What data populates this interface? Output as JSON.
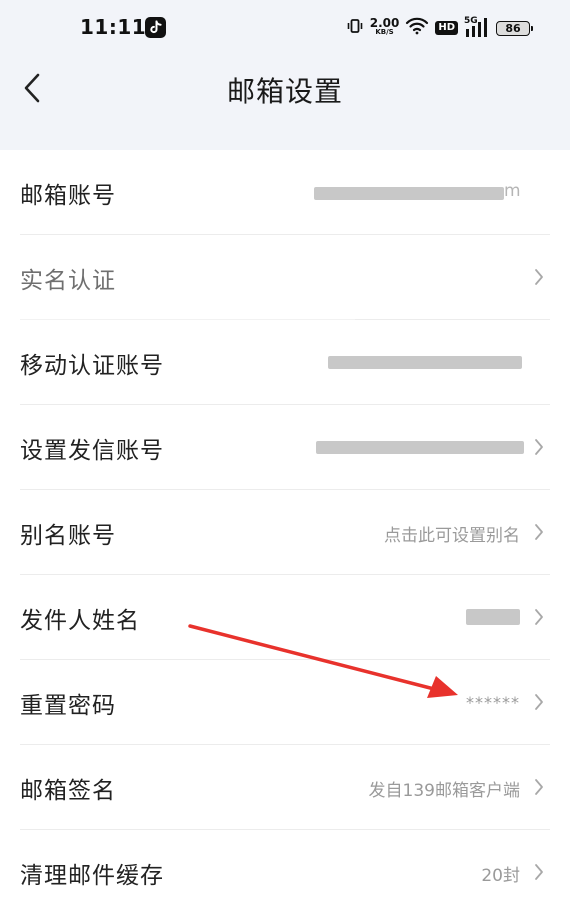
{
  "status_bar": {
    "time": "11:11",
    "net_speed_value": "2.00",
    "net_speed_unit": "KB/S",
    "hd_label": "HD",
    "signal_label": "5G",
    "battery": "86"
  },
  "header": {
    "title": "邮箱设置",
    "back_icon": "chevron-left-icon"
  },
  "settings": {
    "items": [
      {
        "label": "邮箱账号",
        "value": "m",
        "redacted": true
      },
      {
        "label": "实名认证",
        "value": ""
      },
      {
        "label": "移动认证账号",
        "value": "",
        "redacted": true
      },
      {
        "label": "设置发信账号",
        "value": "",
        "redacted": true
      },
      {
        "label": "别名账号",
        "value": "点击此可设置别名"
      },
      {
        "label": "发件人姓名",
        "value": "",
        "redacted": true
      },
      {
        "label": "重置密码",
        "value": "******"
      },
      {
        "label": "邮箱签名",
        "value": "发自139邮箱客户端"
      },
      {
        "label": "清理邮件缓存",
        "value": "20封"
      }
    ]
  },
  "colors": {
    "header_bg": "#f2f4f9",
    "divider": "#ececec",
    "value_text": "#9a9a9a",
    "annotation_arrow": "#e8322c"
  }
}
